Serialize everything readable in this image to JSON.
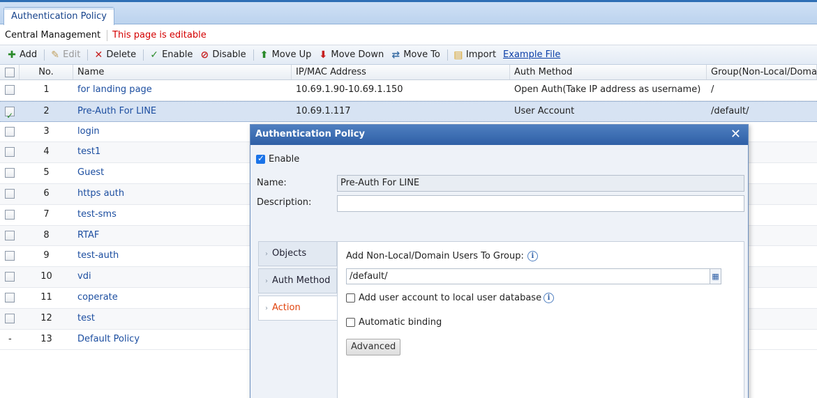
{
  "tab": {
    "label": "Authentication Policy"
  },
  "infobar": {
    "title": "Central Management",
    "editable_note": "This page is editable"
  },
  "toolbar": {
    "add": "Add",
    "edit": "Edit",
    "delete": "Delete",
    "enable": "Enable",
    "disable": "Disable",
    "move_up": "Move Up",
    "move_down": "Move Down",
    "move_to": "Move To",
    "import": "Import",
    "example_file": "Example File"
  },
  "grid": {
    "headers": {
      "no": "No.",
      "name": "Name",
      "ip": "IP/MAC Address",
      "auth": "Auth Method",
      "group": "Group(Non-Local/Domain"
    },
    "rows": [
      {
        "no": "1",
        "name": "for landing page",
        "ip": "10.69.1.90-10.69.1.150",
        "auth": "Open Auth(Take IP address as username)",
        "group": "/"
      },
      {
        "no": "2",
        "name": "Pre-Auth For LINE",
        "ip": "10.69.1.117",
        "auth": "User Account",
        "group": "/default/"
      },
      {
        "no": "3",
        "name": "login",
        "ip": "",
        "auth": "",
        "group": ""
      },
      {
        "no": "4",
        "name": "test1",
        "ip": "",
        "auth": "",
        "group": ""
      },
      {
        "no": "5",
        "name": "Guest",
        "ip": "",
        "auth": "",
        "group": ""
      },
      {
        "no": "6",
        "name": "https auth",
        "ip": "",
        "auth": "",
        "group": ""
      },
      {
        "no": "7",
        "name": "test-sms",
        "ip": "",
        "auth": "",
        "group": ""
      },
      {
        "no": "8",
        "name": "RTAF",
        "ip": "",
        "auth": "",
        "group": ""
      },
      {
        "no": "9",
        "name": "test-auth",
        "ip": "",
        "auth": "",
        "group": ""
      },
      {
        "no": "10",
        "name": "vdi",
        "ip": "",
        "auth": "",
        "group": ""
      },
      {
        "no": "11",
        "name": "coperate",
        "ip": "",
        "auth": "",
        "group": ""
      },
      {
        "no": "12",
        "name": "test",
        "ip": "",
        "auth": "",
        "group": ""
      },
      {
        "no": "13",
        "name": "Default Policy",
        "ip": "",
        "auth": "",
        "group": "",
        "checkbox": "-"
      }
    ]
  },
  "modal": {
    "title": "Authentication Policy",
    "close": "✕",
    "enable_label": "Enable",
    "name_label": "Name:",
    "name_value": "Pre-Auth For LINE",
    "description_label": "Description:",
    "description_value": "",
    "side_tabs": [
      "Objects",
      "Auth Method",
      "Action"
    ],
    "action": {
      "group_label": "Add Non-Local/Domain Users To Group:",
      "group_value": "/default/",
      "add_local_label": "Add user account to local user database",
      "auto_binding_label": "Automatic binding",
      "advanced_button": "Advanced"
    }
  },
  "colors": {
    "accent": "#2e5fa6",
    "editable": "#d40000",
    "active_tab": "#e0420c"
  }
}
